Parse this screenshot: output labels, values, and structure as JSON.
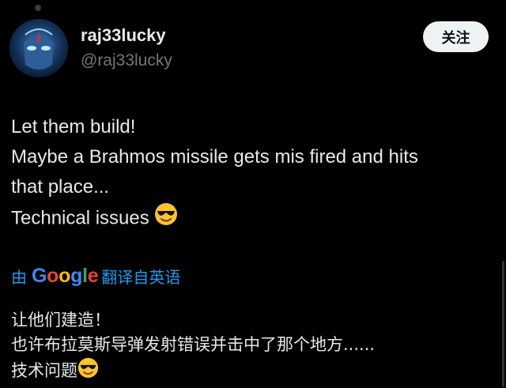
{
  "author": {
    "display_name": "raj33lucky",
    "handle": "@raj33lucky"
  },
  "follow_button": {
    "label": "关注"
  },
  "tweet": {
    "lines": [
      "Let them build!",
      "Maybe a Brahmos missile gets mis fired and hits",
      "that place...",
      "Technical issues"
    ],
    "emoji": "sunglasses-face-emoji"
  },
  "translation": {
    "prefix": "由",
    "provider": "Google",
    "suffix": "翻译自英语",
    "lines": [
      "让他们建造！",
      "也许布拉莫斯导弹发射错误并击中了那个地方......",
      "技术问题"
    ]
  },
  "colors": {
    "background": "#000000",
    "text": "#e7e9ea",
    "secondary_text": "#71767b",
    "link_blue": "#1d9bf0",
    "follow_button_bg": "#eff3f4",
    "google_blue": "#4285F4",
    "google_red": "#EA4335",
    "google_yellow": "#FBBC05",
    "google_green": "#34A853"
  }
}
